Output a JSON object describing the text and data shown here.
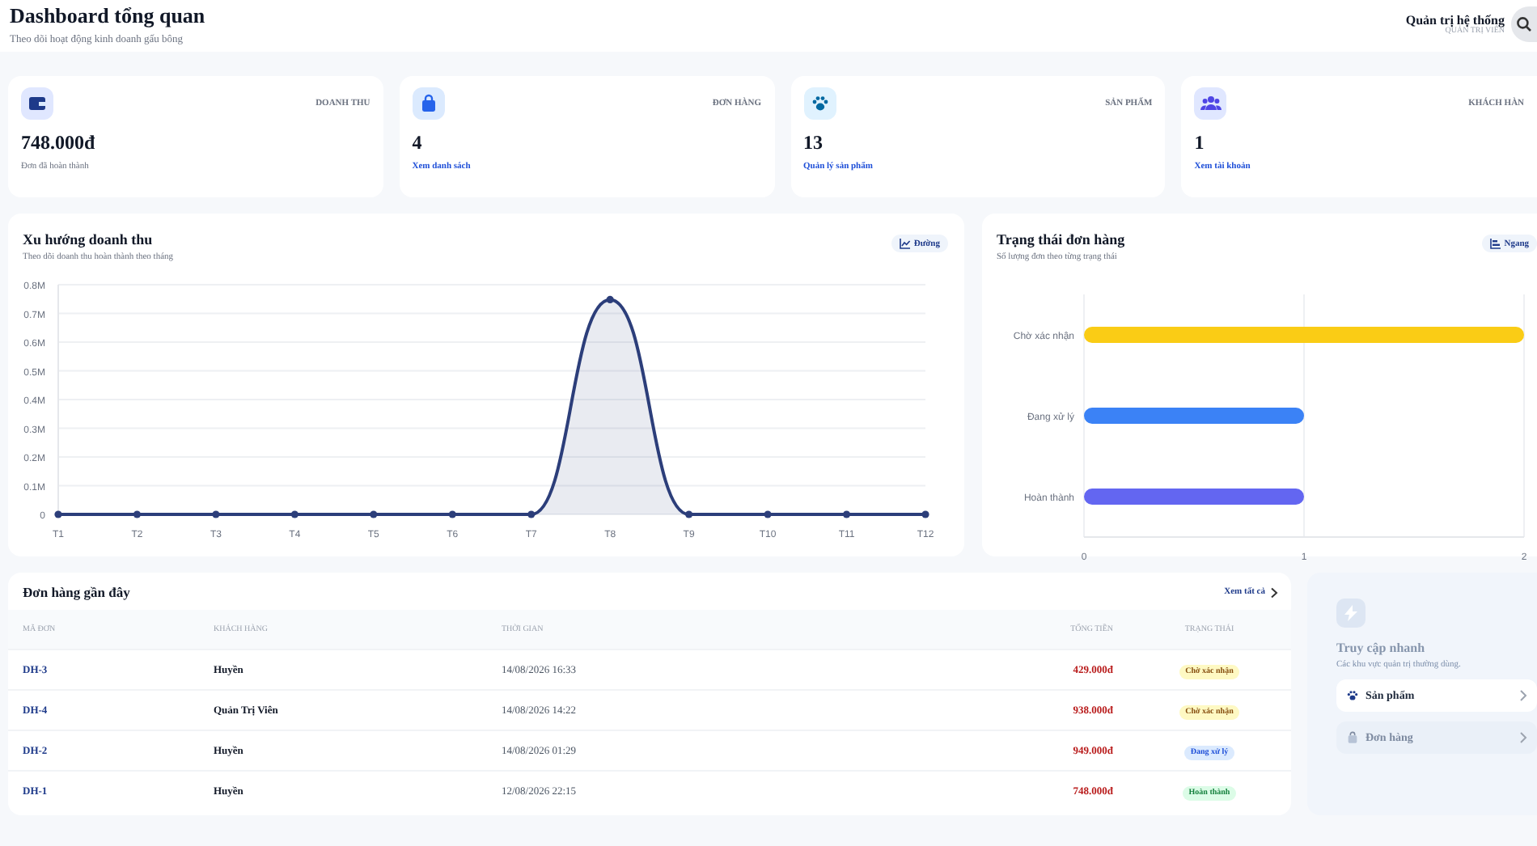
{
  "header": {
    "title": "Dashboard tổng quan",
    "subtitle": "Theo dõi hoạt động kinh doanh gấu bông",
    "user_name": "Quản trị hệ thống",
    "user_role": "QUẢN TRỊ VIÊN"
  },
  "stats": [
    {
      "kind": "revenue",
      "label": "DOANH THU",
      "value": "748.000đ",
      "note": "Đơn đã hoàn thành"
    },
    {
      "kind": "orders",
      "label": "ĐƠN HÀNG",
      "value": "4",
      "link": "Xem danh sách"
    },
    {
      "kind": "products",
      "label": "SẢN PHẨM",
      "value": "13",
      "link": "Quản lý sản phẩm"
    },
    {
      "kind": "customers",
      "label": "KHÁCH HÀN",
      "value": "1",
      "link": "Xem tài khoản"
    }
  ],
  "revenue_chart": {
    "title": "Xu hướng doanh thu",
    "subtitle": "Theo dõi doanh thu hoàn thành theo tháng",
    "toggle": "Đường",
    "chart_data": {
      "type": "area",
      "categories": [
        "T1",
        "T2",
        "T3",
        "T4",
        "T5",
        "T6",
        "T7",
        "T8",
        "T9",
        "T10",
        "T11",
        "T12"
      ],
      "values": [
        0,
        0,
        0,
        0,
        0,
        0,
        0,
        748000,
        0,
        0,
        0,
        0
      ],
      "color": "#2c3e7a",
      "grid": true,
      "ylim": [
        0,
        800000
      ],
      "yticks": [
        {
          "value": 0,
          "label": "0"
        },
        {
          "value": 100000,
          "label": "0.1M"
        },
        {
          "value": 200000,
          "label": "0.2M"
        },
        {
          "value": 300000,
          "label": "0.3M"
        },
        {
          "value": 400000,
          "label": "0.4M"
        },
        {
          "value": 500000,
          "label": "0.5M"
        },
        {
          "value": 600000,
          "label": "0.6M"
        },
        {
          "value": 700000,
          "label": "0.7M"
        },
        {
          "value": 800000,
          "label": "0.8M"
        }
      ]
    }
  },
  "status_chart": {
    "title": "Trạng thái đơn hàng",
    "subtitle": "Số lượng đơn theo từng trạng thái",
    "toggle": "Ngang",
    "chart_data": {
      "type": "bar",
      "orientation": "horizontal",
      "categories": [
        "Chờ xác nhận",
        "Đang xử lý",
        "Hoàn thành"
      ],
      "values": [
        2,
        1,
        1
      ],
      "colors": [
        "#facc15",
        "#3b82f6",
        "#6366f1"
      ],
      "grid": true,
      "xlim": [
        0,
        2
      ],
      "xticks": [
        0,
        1,
        2
      ]
    }
  },
  "recent_orders": {
    "title": "Đơn hàng gần đây",
    "view_all": "Xem tất cả",
    "columns": [
      "MÃ ĐƠN",
      "KHÁCH HÀNG",
      "THỜI GIAN",
      "TỔNG TIỀN",
      "TRẠNG THÁI"
    ],
    "rows": [
      {
        "id": "DH-3",
        "customer": "Huyền",
        "time": "14/08/2026 16:33",
        "total": "429.000đ",
        "status": "Chờ xác nhận",
        "kind": "pending"
      },
      {
        "id": "DH-4",
        "customer": "Quản Trị Viên",
        "time": "14/08/2026 14:22",
        "total": "938.000đ",
        "status": "Chờ xác nhận",
        "kind": "pending"
      },
      {
        "id": "DH-2",
        "customer": "Huyền",
        "time": "14/08/2026 01:29",
        "total": "949.000đ",
        "status": "Đang xử lý",
        "kind": "processing"
      },
      {
        "id": "DH-1",
        "customer": "Huyền",
        "time": "12/08/2026 22:15",
        "total": "748.000đ",
        "status": "Hoàn thành",
        "kind": "done"
      }
    ]
  },
  "quick_access": {
    "title": "Truy cập nhanh",
    "subtitle": "Các khu vực quản trị thường dùng.",
    "items": [
      {
        "kind": "products",
        "label": "Sản phẩm",
        "selected": true
      },
      {
        "kind": "orders",
        "label": "Đơn hàng",
        "selected": false
      }
    ]
  }
}
